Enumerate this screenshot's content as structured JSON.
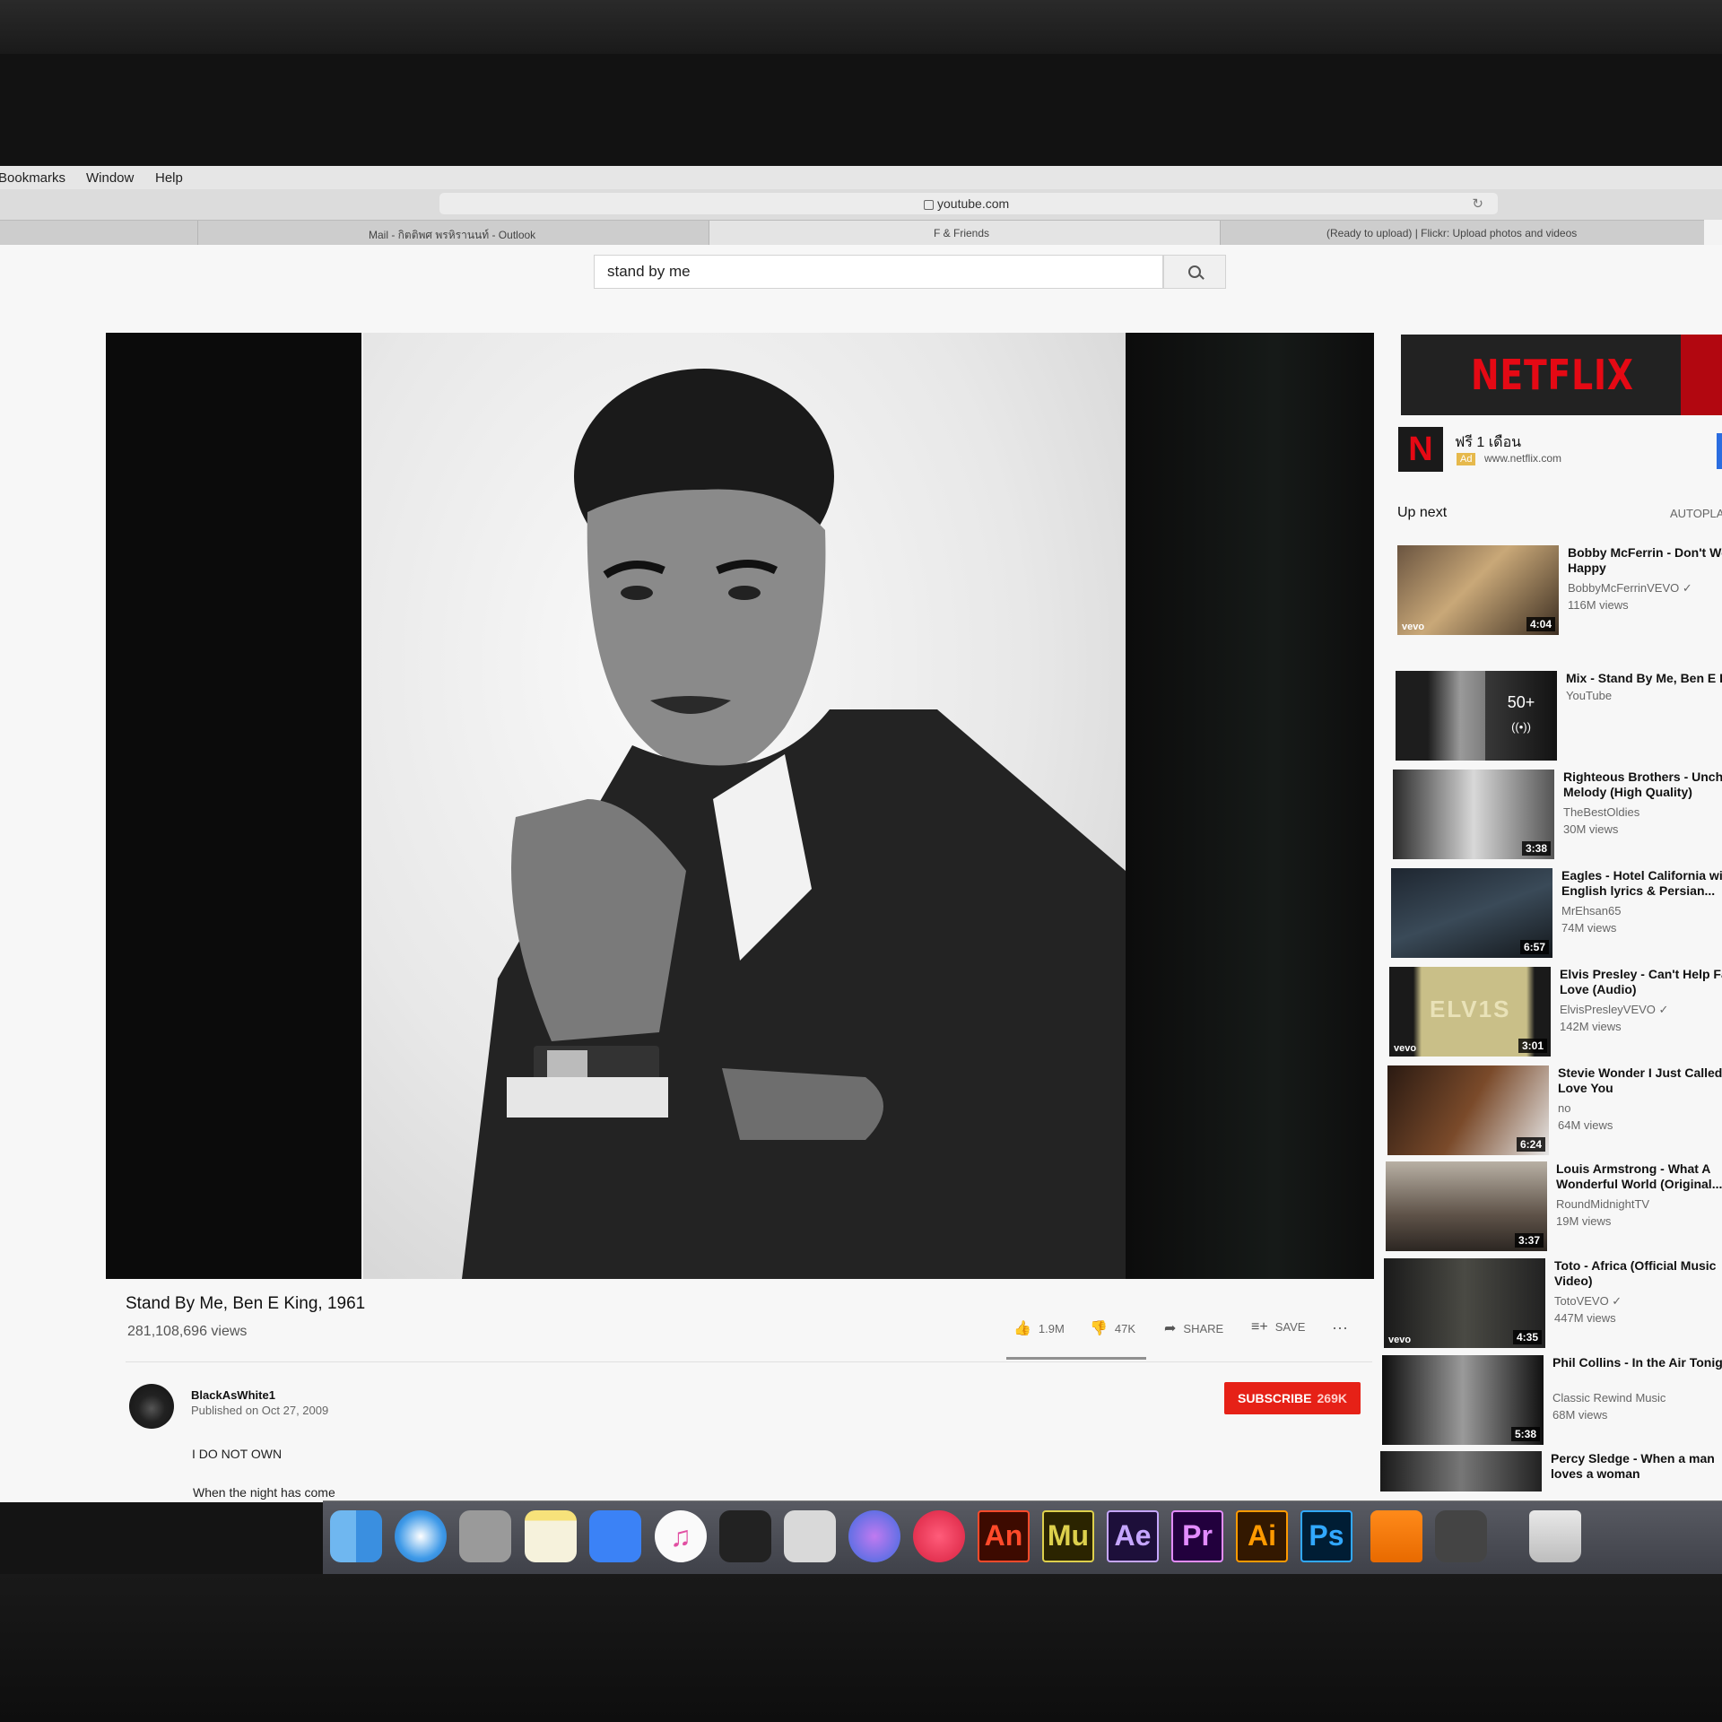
{
  "menubar": {
    "items": [
      "Bookmarks",
      "Window",
      "Help"
    ]
  },
  "browser": {
    "url": "youtube.com",
    "tabs": [
      "Mail - กิตติพศ พรหิรานนท์ - Outlook",
      "F & Friends",
      "(Ready to upload) | Flickr: Upload photos and videos"
    ]
  },
  "search": {
    "query": "stand by me"
  },
  "video": {
    "title": "Stand By Me, Ben E King, 1961",
    "views": "281,108,696 views",
    "likes": "1.9M",
    "dislikes": "47K",
    "share_label": "SHARE",
    "save_label": "SAVE",
    "like_ratio": 0.976
  },
  "channel": {
    "name": "BlackAsWhite1",
    "published": "Published on Oct 27, 2009",
    "subscribe_label": "SUBSCRIBE",
    "subscriber_count": "269K"
  },
  "description": {
    "line1": "I DO NOT OWN",
    "line2": "When the night has come"
  },
  "ad": {
    "banner_logo": "NETFLIX",
    "logo_letter": "N",
    "headline": "ฟรี 1 เดือน",
    "badge": "Ad",
    "url": "www.netflix.com"
  },
  "sidebar": {
    "upnext_label": "Up next",
    "autoplay_label": "AUTOPLA",
    "videos": [
      {
        "title": "Bobby McFerrin - Don't Wo Happy",
        "channel": "BobbyMcFerrinVEVO ✓",
        "views": "116M views",
        "duration": "4:04",
        "vevo": true
      },
      {
        "title": "Mix - Stand By Me, Ben E K",
        "channel": "YouTube",
        "views": "",
        "duration": "",
        "mix_count": "50+",
        "mix_icon": "((•))"
      },
      {
        "title": "Righteous Brothers - Uncha Melody (High Quality)",
        "channel": "TheBestOldies",
        "views": "30M views",
        "duration": "3:38"
      },
      {
        "title": "Eagles - Hotel California wi English lyrics & Persian...",
        "channel": "MrEhsan65",
        "views": "74M views",
        "duration": "6:57"
      },
      {
        "title": "Elvis Presley - Can't Help Fa In Love (Audio)",
        "channel": "ElvisPresleyVEVO ✓",
        "views": "142M views",
        "duration": "3:01",
        "vevo": true,
        "thumb_text": "ELV1S"
      },
      {
        "title": "Stevie Wonder I Just Called Say I Love You",
        "channel": "no",
        "views": "64M views",
        "duration": "6:24"
      },
      {
        "title": "Louis Armstrong - What A Wonderful World (Original...",
        "channel": "RoundMidnightTV",
        "views": "19M views",
        "duration": "3:37"
      },
      {
        "title": "Toto - Africa (Official Music Video)",
        "channel": "TotoVEVO ✓",
        "views": "447M views",
        "duration": "4:35",
        "vevo": true
      },
      {
        "title": "Phil Collins - In the Air Tonigh",
        "channel": "Classic Rewind Music",
        "views": "68M views",
        "duration": "5:38"
      },
      {
        "title": "Percy Sledge - When a man loves a woman",
        "channel": "",
        "views": "",
        "duration": ""
      }
    ]
  },
  "dock": [
    {
      "name": "finder",
      "label": ""
    },
    {
      "name": "safari",
      "label": ""
    },
    {
      "name": "screenshot",
      "label": ""
    },
    {
      "name": "notes",
      "label": ""
    },
    {
      "name": "keynote",
      "label": ""
    },
    {
      "name": "itunes",
      "label": "♫"
    },
    {
      "name": "final-cut",
      "label": ""
    },
    {
      "name": "preview",
      "label": ""
    },
    {
      "name": "motion",
      "label": ""
    },
    {
      "name": "davinci",
      "label": ""
    },
    {
      "name": "animate",
      "label": "An"
    },
    {
      "name": "muse",
      "label": "Mu"
    },
    {
      "name": "after-effects",
      "label": "Ae"
    },
    {
      "name": "premiere",
      "label": "Pr"
    },
    {
      "name": "illustrator",
      "label": "Ai"
    },
    {
      "name": "photoshop",
      "label": "Ps"
    },
    {
      "name": "vlc",
      "label": ""
    },
    {
      "name": "claquette",
      "label": ""
    },
    {
      "name": "trash",
      "label": ""
    }
  ],
  "colors": {
    "subscribe": "#e62117",
    "netflix": "#e50914",
    "accent": "#2b6de0"
  }
}
